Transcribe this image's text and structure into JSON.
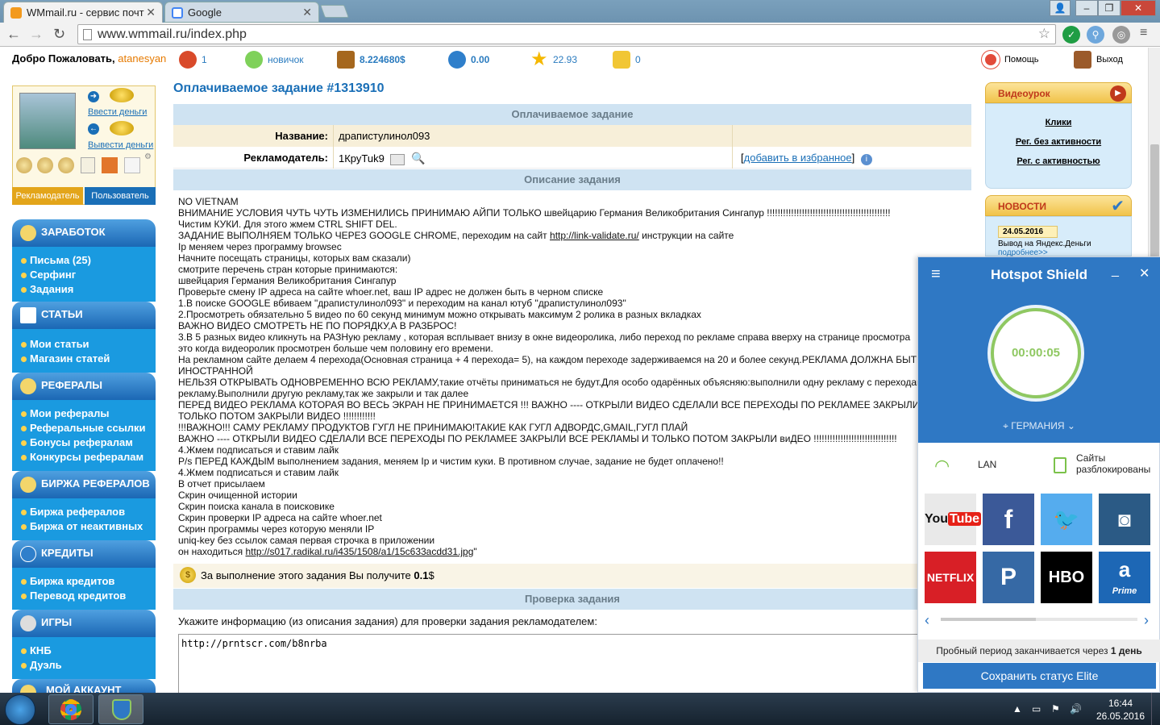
{
  "browser": {
    "tabs": [
      {
        "label": "WMmail.ru - сервис почт"
      },
      {
        "label": "Google"
      }
    ],
    "url": "www.wmmail.ru/index.php"
  },
  "header": {
    "welcome": "Добро Пожаловать,",
    "username": "atanesyan",
    "stats": [
      {
        "icon": "refresh-icon",
        "value": "1"
      },
      {
        "icon": "flask-icon",
        "value": "новичок"
      },
      {
        "icon": "treasure-chest-icon",
        "value": "8.224680$"
      },
      {
        "icon": "credit-coin-icon",
        "value": "0.00"
      },
      {
        "icon": "star-icon",
        "value": "22.93"
      },
      {
        "icon": "coin-stack-icon",
        "value": "0"
      }
    ],
    "help": "Помощь",
    "logout": "Выход"
  },
  "user": {
    "deposit": "Ввести деньги",
    "withdraw": "Вывести деньги",
    "role_advertiser": "Рекламодатель",
    "role_user": "Пользователь"
  },
  "menu": [
    {
      "title": "ЗАРАБОТОК",
      "items": [
        "Письма (25)",
        "Серфинг",
        "Задания"
      ]
    },
    {
      "title": "СТАТЬИ",
      "items": [
        "Мои статьи",
        "Магазин статей"
      ]
    },
    {
      "title": "РЕФЕРАЛЫ",
      "items": [
        "Мои рефералы",
        "Реферальные ссылки",
        "Бонусы рефералам",
        "Конкурсы рефералам"
      ]
    },
    {
      "title": "БИРЖА РЕФЕРАЛОВ",
      "items": [
        "Биржа рефералов",
        "Биржа от неактивных"
      ]
    },
    {
      "title": "КРЕДИТЫ",
      "items": [
        "Биржа кредитов",
        "Перевод кредитов"
      ]
    },
    {
      "title": "ИГРЫ",
      "items": [
        "КНБ",
        "Дуэль"
      ]
    },
    {
      "title": "МОЙ АККАУНТ",
      "items": []
    }
  ],
  "task": {
    "title": "Оплачиваемое задание #1313910",
    "section_header": "Оплачиваемое задание",
    "name_label": "Название:",
    "name_value": "драпистулинол093",
    "advertiser_label": "Рекламодатель:",
    "advertiser_value": "1КруTuk9",
    "favorite_open": "[",
    "favorite_link": "добавить в избранное",
    "favorite_close": "]",
    "desc_header": "Описание задания",
    "description": [
      "NO VIETNAM",
      "ВНИМАНИЕ УСЛОВИЯ ЧУТЬ ЧУТЬ ИЗМЕНИЛИСЬ ПРИНИМАЮ АЙПИ ТОЛЬКО швейцарию Германия Великобритания Сингапур !!!!!!!!!!!!!!!!!!!!!!!!!!!!!!!!!!!!!!!!!!!!!!",
      "Чистим КУКИ. Для этого жмем CTRL SHIFT DEL.",
      "ЗАДАНИЕ ВЫПОЛНЯЕМ ТОЛЬКО ЧЕРЕЗ GOOGLE CHROME, переходим на сайт ",
      "Ip меняем через программу browsec",
      "Начните посещать страницы, которых вам сказали)",
      "смотрите перечень стран которые принимаются:",
      "швейцария Германия Великобритания Сингапур",
      "Проверьте смену IP адреса на сайте whoer.net, ваш IP адрес не должен быть в черном списке",
      "1.В поиске GOOGLE вбиваем \"драпистулинол093\" и переходим на канал ютуб \"драпистулинол093\"",
      "2.Просмотреть обязательно 5 видео по 60 секунд минимум можно открывать максимум 2 ролика в разных вкладках",
      "ВАЖНО ВИДЕО СМОТРЕТЬ НЕ ПО ПОРЯДКУ,А В РАЗБРОС!",
      "3.В 5 разных видео кликнуть на РАЗНую рекламу , которая всплывает внизу в окне видеоролика, либо переход по рекламе справа вверху на странице просмотра",
      "это когда видеоролик просмотрен больше чем половину его времени.",
      "На рекламном сайте делаем 4 перехода(Основная страница + 4 перехода= 5), на каждом переходе задерживаемся на 20 и более секунд.РЕКЛАМА ДОЛЖНА БЫТЬ",
      "ИНОСТРАННОЙ",
      "НЕЛЬЗЯ ОТКРЫВАТЬ ОДНОВРЕМЕННО ВСЮ РЕКЛАМУ,такие отчёты приниматься не будут.Для особо одарённых объясняю:выполнили одну рекламу с переходами",
      "рекламу.Выполнили другую рекламу,так же закрыли и так далее",
      "ПЕРЕД ВИДЕО РЕКЛАМА КОТОРАЯ ВО ВЕСЬ ЭКРАН НЕ ПРИНИМАЕТСЯ !!! ВАЖНО ---- ОТКРЫЛИ ВИДЕО СДЕЛАЛИ ВСЕ ПЕРЕХОДЫ ПО РЕКЛАМЕЕ ЗАКРЫЛИ ВСЕ РЕКЛАМЫ И",
      "ТОЛЬКО ПОТОМ ЗАКРЫЛИ ВИДЕО !!!!!!!!!!!!",
      "!!!ВАЖНО!!! САМУ РЕКЛАМУ ПРОДУКТОВ ГУГЛ НЕ ПРИНИМАЮ!ТАКИЕ КАК ГУГЛ АДВОРДС,GMAIL,ГУГЛ ПЛАЙ",
      "ВАЖНО ---- ОТКРЫЛИ ВИДЕО СДЕЛАЛИ ВСЕ ПЕРЕХОДЫ ПО РЕКЛАМЕЕ ЗАКРЫЛИ ВСЕ РЕКЛАМЫ И ТОЛЬКО ПОТОМ ЗАКРЫЛИ виДЕО !!!!!!!!!!!!!!!!!!!!!!!!!!!!!!!",
      "4.Жмем подписаться и ставим лайк",
      "P/s ПЕРЕД КАЖДЫМ выполнением задания, меняем Ip и чистим куки. В противном случае, задание не будет оплачено!!",
      "4.Жмем подписаться и ставим лайк",
      "В отчет присылаем",
      "Скрин очищенной истории",
      "Скрин поиска канала в поисковике",
      "Скрин проверки IP адреса на сайте whoer.net",
      "Скрин программы через которую меняли IP",
      "uniq-key без ссылок самая первая строчка в приложении",
      "он находиться "
    ],
    "link1": "http://link-validate.ru/",
    "link1_after": " инструкции на сайте",
    "link2": "http://s017.radikal.ru/i435/1508/a1/15c633acdd31.jpg",
    "link2_after": "\"",
    "reward_text": "За выполнение этого задания Вы получите ",
    "reward_amount": "0.1",
    "reward_currency": "$",
    "check_header": "Проверка задания",
    "check_label": "Укажите информацию (из описания задания) для проверки задания рекламодателем:",
    "answer_value": "http://prntscr.com/b8nrba"
  },
  "right": {
    "video_title": "Видеоурок",
    "video_links": [
      "Клики",
      "Рег. без активности",
      "Рег. с активностью"
    ],
    "news_title": "НОВОСТИ",
    "news_date": "24.05.2016",
    "news_text": "Вывод на Яндекс.Деньги",
    "news_more": "подробнее>>"
  },
  "hotspot": {
    "title": "Hotspot Shield",
    "timer": "00:00:05",
    "location": "ГЕРМАНИЯ",
    "network": "LAN",
    "sites_line1": "Сайты",
    "sites_line2": "разблокированы",
    "apps": [
      "YouTube",
      "Facebook",
      "Twitter",
      "Instagram",
      "NETFLIX",
      "Pandora",
      "HBO",
      "Amazon Prime"
    ],
    "trial_text": "Пробный период заканчивается через ",
    "trial_days": "1 день",
    "save_button": "Сохранить статус Elite"
  },
  "taskbar": {
    "time": "16:44",
    "date": "26.05.2016"
  },
  "colors": {
    "accent_blue": "#1a6fb7",
    "menu_blue": "#1a9ae0",
    "hs_blue": "#2f78c4",
    "timer_green": "#8fc862"
  }
}
